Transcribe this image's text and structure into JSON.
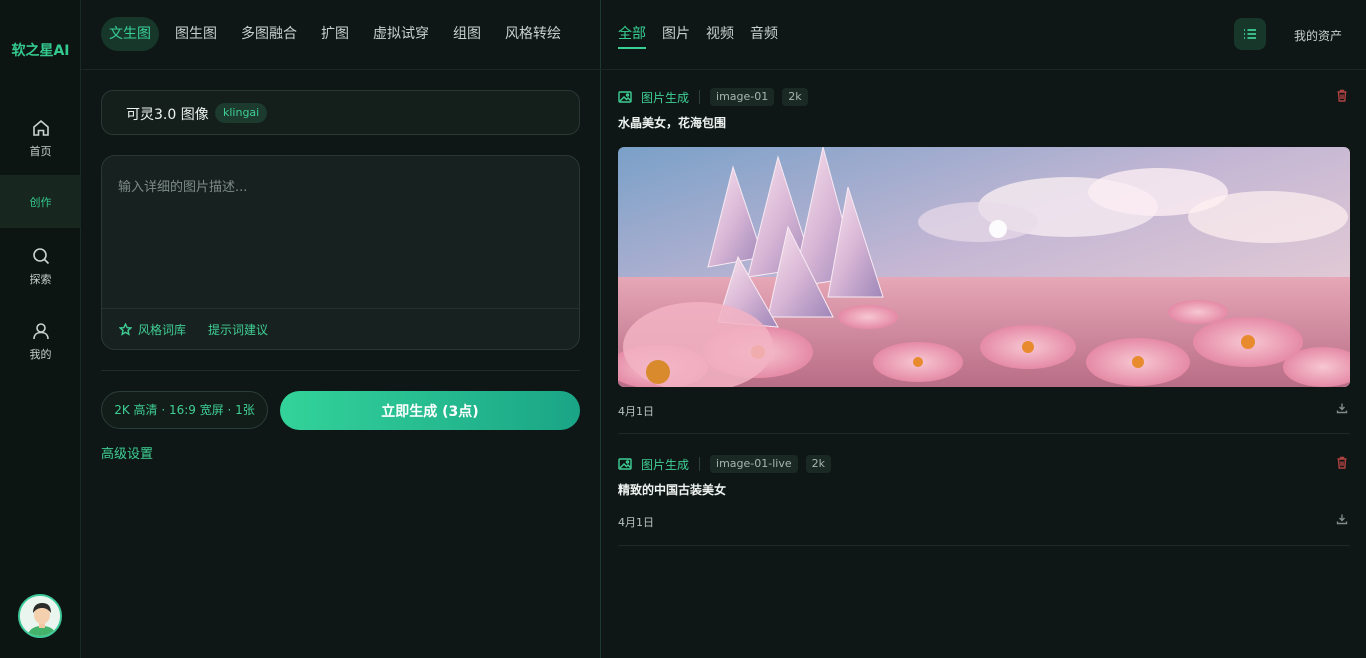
{
  "brand": {
    "logo_text": "软之星AI"
  },
  "sidebar": {
    "items": [
      {
        "label": "首页",
        "icon": "home-icon"
      },
      {
        "label": "创作",
        "icon": "create-icon"
      },
      {
        "label": "探索",
        "icon": "search-icon"
      },
      {
        "label": "我的",
        "icon": "user-icon"
      }
    ],
    "active_index": 1
  },
  "creation_tabs": [
    "文生图",
    "图生图",
    "多图融合",
    "扩图",
    "虚拟试穿",
    "组图",
    "风格转绘"
  ],
  "active_creation_tab": "文生图",
  "model": {
    "name": "可灵3.0 图像",
    "tag": "klingai"
  },
  "prompt": {
    "placeholder": "输入详细的图片描述...",
    "value": "",
    "style_library_label": "风格词库",
    "suggestion_label": "提示词建议"
  },
  "generation": {
    "settings_summary": "2K 高清 · 16:9 宽屏 · 1张",
    "generate_label": "立即生成 (3点)",
    "advanced_label": "高级设置"
  },
  "results_filter": {
    "tabs": [
      "全部",
      "图片",
      "视频",
      "音频"
    ],
    "active": "全部",
    "assets_label": "我的资产"
  },
  "results": [
    {
      "type_label": "图片生成",
      "model_chip": "image-01",
      "quality_chip": "2k",
      "prompt": "水晶美女，花海包围",
      "date": "4月1日",
      "has_image": true,
      "image_desc": "pink crystal cluster in a field of pink daisies under a pastel sky"
    },
    {
      "type_label": "图片生成",
      "model_chip": "image-01-live",
      "quality_chip": "2k",
      "prompt": "精致的中国古装美女",
      "date": "4月1日",
      "has_image": false
    }
  ],
  "colors": {
    "accent": "#3fcf95",
    "background": "#0e1715",
    "panel": "#172220",
    "danger": "#b04242"
  }
}
